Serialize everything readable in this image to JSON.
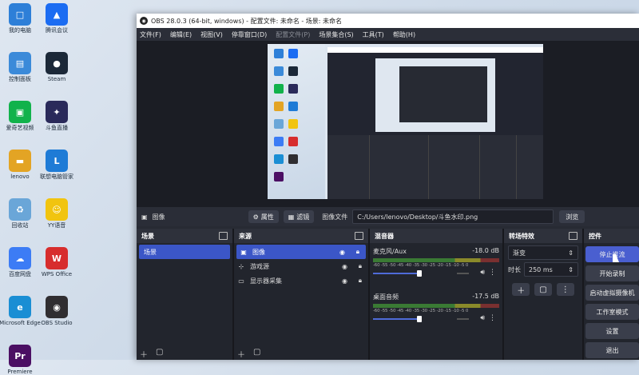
{
  "desktop": {
    "icons": [
      {
        "label": "我的电脑",
        "color": "#2d7fd8",
        "glyph": "□",
        "col": 0,
        "row": 0
      },
      {
        "label": "腾讯会议",
        "color": "#1b6cf2",
        "glyph": "▲",
        "col": 1,
        "row": 0
      },
      {
        "label": "控制面板",
        "color": "#3b8ad9",
        "glyph": "▤",
        "col": 0,
        "row": 1
      },
      {
        "label": "Steam",
        "color": "#1b2838",
        "glyph": "●",
        "col": 1,
        "row": 1
      },
      {
        "label": "爱奇艺视频",
        "color": "#11b24b",
        "glyph": "▣",
        "col": 0,
        "row": 2
      },
      {
        "label": "斗鱼直播",
        "color": "#2a2a5a",
        "glyph": "✦",
        "col": 1,
        "row": 2
      },
      {
        "label": "lenovo",
        "color": "#e3a424",
        "glyph": "▬",
        "col": 0,
        "row": 3
      },
      {
        "label": "联想电脑管家",
        "color": "#1e7bd6",
        "glyph": "L",
        "col": 1,
        "row": 3
      },
      {
        "label": "回收站",
        "color": "#6aa6d8",
        "glyph": "♻",
        "col": 0,
        "row": 4
      },
      {
        "label": "YY语音",
        "color": "#f1c40f",
        "glyph": "☺",
        "col": 1,
        "row": 4
      },
      {
        "label": "百度网盘",
        "color": "#3c7cf5",
        "glyph": "☁",
        "col": 0,
        "row": 5
      },
      {
        "label": "WPS Office",
        "color": "#d72d2d",
        "glyph": "W",
        "col": 1,
        "row": 5
      },
      {
        "label": "Microsoft Edge",
        "color": "#1a8ed4",
        "glyph": "e",
        "col": 0,
        "row": 6
      },
      {
        "label": "OBS Studio",
        "color": "#302e31",
        "glyph": "◉",
        "col": 1,
        "row": 6
      },
      {
        "label": "Premiere",
        "color": "#4b0f63",
        "glyph": "Pr",
        "col": 0,
        "row": 7
      }
    ]
  },
  "window": {
    "title": "OBS 28.0.3 (64-bit, windows) - 配置文件: 未命名 - 场景: 未命名"
  },
  "menu": [
    "文件(F)",
    "编辑(E)",
    "视图(V)",
    "停靠窗口(D)",
    "配置文件(P)",
    "场景集合(S)",
    "工具(T)",
    "帮助(H)"
  ],
  "propbar": {
    "source_name": "图像",
    "properties_label": "属性",
    "filters_label": "滤镜",
    "file_label": "图像文件",
    "file_path": "C:/Users/lenovo/Desktop/斗鱼水印.png",
    "browse_label": "浏览"
  },
  "scenes": {
    "title": "场景",
    "items": [
      "场景"
    ]
  },
  "sources": {
    "title": "来源",
    "items": [
      {
        "name": "图像",
        "icon": "image-icon"
      },
      {
        "name": "游戏源",
        "icon": "gamepad-icon"
      },
      {
        "name": "显示器采集",
        "icon": "monitor-icon"
      }
    ]
  },
  "mixer": {
    "title": "混音器",
    "scale": "-60 -55 -50 -45 -40 -35 -30 -25 -20 -15 -10 -5 0",
    "tracks": [
      {
        "name": "麦克风/Aux",
        "db": "-18.0 dB",
        "fader": 0.46
      },
      {
        "name": "桌面音频",
        "db": "-17.5 dB",
        "fader": 0.46
      }
    ]
  },
  "transitions": {
    "title": "转场特效",
    "type": "渐变",
    "duration_label": "时长",
    "duration": "250 ms"
  },
  "controls": {
    "title": "控件",
    "buttons": [
      "停止推流",
      "开始录制",
      "启动虚拟摄像机",
      "工作室模式",
      "设置",
      "退出"
    ]
  },
  "colors": {
    "accent": "#3b56c7",
    "panel": "#22252d"
  }
}
